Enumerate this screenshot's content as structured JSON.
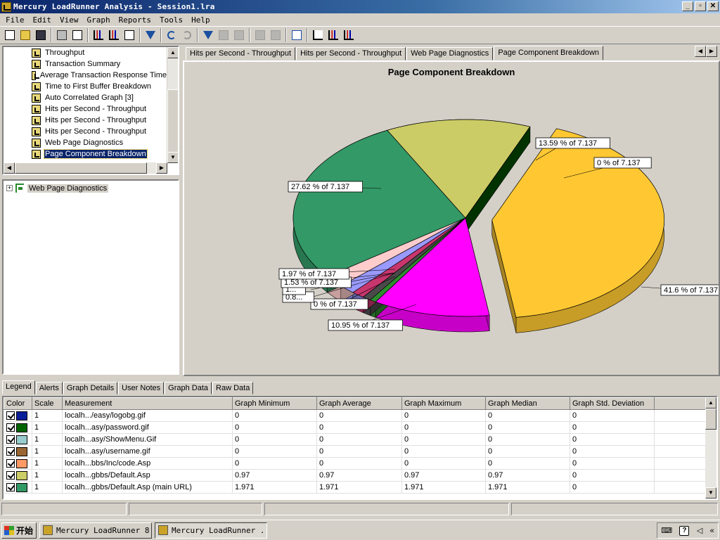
{
  "window": {
    "title": "Mercury LoadRunner Analysis - Session1.lra",
    "buttons": [
      "_",
      "▫",
      "✕"
    ]
  },
  "menu": [
    "File",
    "Edit",
    "View",
    "Graph",
    "Reports",
    "Tools",
    "Help"
  ],
  "tree": {
    "items": [
      {
        "label": "Throughput",
        "selected": false
      },
      {
        "label": "Transaction Summary",
        "selected": false
      },
      {
        "label": "Average Transaction Response Time",
        "selected": false
      },
      {
        "label": "Time to First Buffer Breakdown",
        "selected": false
      },
      {
        "label": "Auto Correlated Graph [3]",
        "selected": false
      },
      {
        "label": "Hits per Second - Throughput",
        "selected": false
      },
      {
        "label": "Hits per Second - Throughput",
        "selected": false
      },
      {
        "label": "Hits per Second - Throughput",
        "selected": false
      },
      {
        "label": "Web Page Diagnostics",
        "selected": false
      },
      {
        "label": "Page Component Breakdown",
        "selected": true
      }
    ]
  },
  "lower_tree": {
    "node_label": "Web Page Diagnostics",
    "expander": "+"
  },
  "graph_tabs": [
    {
      "label": "Hits per Second - Throughput",
      "active": false
    },
    {
      "label": "Hits per Second - Throughput",
      "active": false
    },
    {
      "label": "Web Page Diagnostics",
      "active": false
    },
    {
      "label": "Page Component Breakdown",
      "active": true
    }
  ],
  "chart_data": {
    "type": "pie",
    "title": "Page Component Breakdown",
    "total": 7.137,
    "slices": [
      {
        "label": "41.6 % of 7.137",
        "percent": 41.6,
        "color": "#ffc832",
        "exploded": true
      },
      {
        "label": "10.95 % of 7.137",
        "percent": 10.95,
        "color": "#ff00ff",
        "exploded": false
      },
      {
        "label": "0 % of 7.137",
        "percent": 0.6,
        "color": "#2e8b2e",
        "exploded": false
      },
      {
        "label": "0.8...",
        "percent": 0.8,
        "color": "#4a4a4a",
        "exploded": false
      },
      {
        "label": "1...",
        "percent": 1.2,
        "color": "#c8366e",
        "exploded": false
      },
      {
        "label": "1.53 % of 7.137",
        "percent": 1.53,
        "color": "#9999ff",
        "exploded": false
      },
      {
        "label": "1.97 % of 7.137",
        "percent": 1.97,
        "color": "#ffcccc",
        "exploded": false
      },
      {
        "label": "27.62 % of 7.137",
        "percent": 27.62,
        "color": "#339966",
        "exploded": false
      },
      {
        "label": "13.59 % of 7.137",
        "percent": 13.59,
        "color": "#cccc66",
        "exploded": false
      },
      {
        "label": "0 % of 7.137",
        "percent": 0.0,
        "color": "#004d00",
        "exploded": false
      }
    ]
  },
  "bottom_tabs": [
    {
      "label": "Legend",
      "active": true
    },
    {
      "label": "Alerts",
      "active": false
    },
    {
      "label": "Graph Details",
      "active": false
    },
    {
      "label": "User Notes",
      "active": false
    },
    {
      "label": "Graph Data",
      "active": false
    },
    {
      "label": "Raw Data",
      "active": false
    }
  ],
  "legend": {
    "columns": [
      "Color",
      "Scale",
      "Measurement",
      "Graph Minimum",
      "Graph Average",
      "Graph Maximum",
      "Graph Median",
      "Graph Std. Deviation"
    ],
    "rows": [
      {
        "color": "#0a1e9a",
        "scale": "1",
        "measurement": "localh.../easy/logobg.gif",
        "min": "0",
        "avg": "0",
        "max": "0",
        "median": "0",
        "std": "0"
      },
      {
        "color": "#006400",
        "scale": "1",
        "measurement": "localh...asy/password.gif",
        "min": "0",
        "avg": "0",
        "max": "0",
        "median": "0",
        "std": "0"
      },
      {
        "color": "#99cccc",
        "scale": "1",
        "measurement": "localh...asy/ShowMenu.Gif",
        "min": "0",
        "avg": "0",
        "max": "0",
        "median": "0",
        "std": "0"
      },
      {
        "color": "#996633",
        "scale": "1",
        "measurement": "localh...asy/username.gif",
        "min": "0",
        "avg": "0",
        "max": "0",
        "median": "0",
        "std": "0"
      },
      {
        "color": "#ff9966",
        "scale": "1",
        "measurement": "localh...bbs/Inc/code.Asp",
        "min": "0",
        "avg": "0",
        "max": "0",
        "median": "0",
        "std": "0"
      },
      {
        "color": "#cccc66",
        "scale": "1",
        "measurement": "localh...gbbs/Default.Asp",
        "min": "0.97",
        "avg": "0.97",
        "max": "0.97",
        "median": "0.97",
        "std": "0"
      },
      {
        "color": "#339966",
        "scale": "1",
        "measurement": "localh...gbbs/Default.Asp (main URL)",
        "min": "1.971",
        "avg": "1.971",
        "max": "1.971",
        "median": "1.971",
        "std": "0"
      }
    ]
  },
  "taskbar": {
    "start_label": "开始",
    "tasks": [
      {
        "label": "Mercury LoadRunner 8.1",
        "active": false
      },
      {
        "label": "Mercury LoadRunner ...",
        "active": true
      }
    ],
    "tray": {
      "help": "?",
      "chevron": "«"
    }
  }
}
